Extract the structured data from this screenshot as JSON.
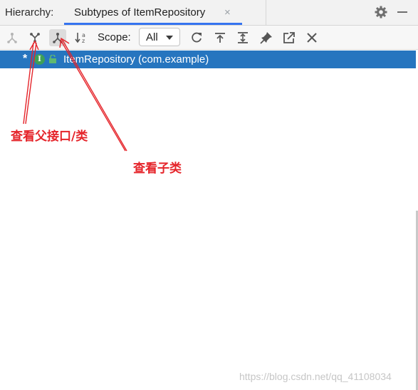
{
  "header": {
    "hierarchy_label": "Hierarchy:",
    "tab_title": "Subtypes of ItemRepository",
    "tab_close": "×"
  },
  "toolbar": {
    "scope_label": "Scope:",
    "scope_value": "All",
    "buttons": [
      "type-hierarchy-icon",
      "supertypes-hierarchy-icon",
      "subtypes-hierarchy-icon",
      "sort-alphabetically-icon",
      "refresh-icon",
      "export-icon",
      "expand-all-icon",
      "pin-icon",
      "open-in-window-icon",
      "close-icon"
    ]
  },
  "tree": {
    "row_marker": "*",
    "icon_letter": "I",
    "item_label": "ItemRepository (com.example)"
  },
  "annotations": {
    "supertypes": "查看父接口/类",
    "subtypes": "查看子类"
  },
  "watermark": "https://blog.csdn.net/qq_41108034",
  "colors": {
    "selection": "#2675bf",
    "annotation": "#e5242a",
    "tab_underline": "#3574f0"
  }
}
